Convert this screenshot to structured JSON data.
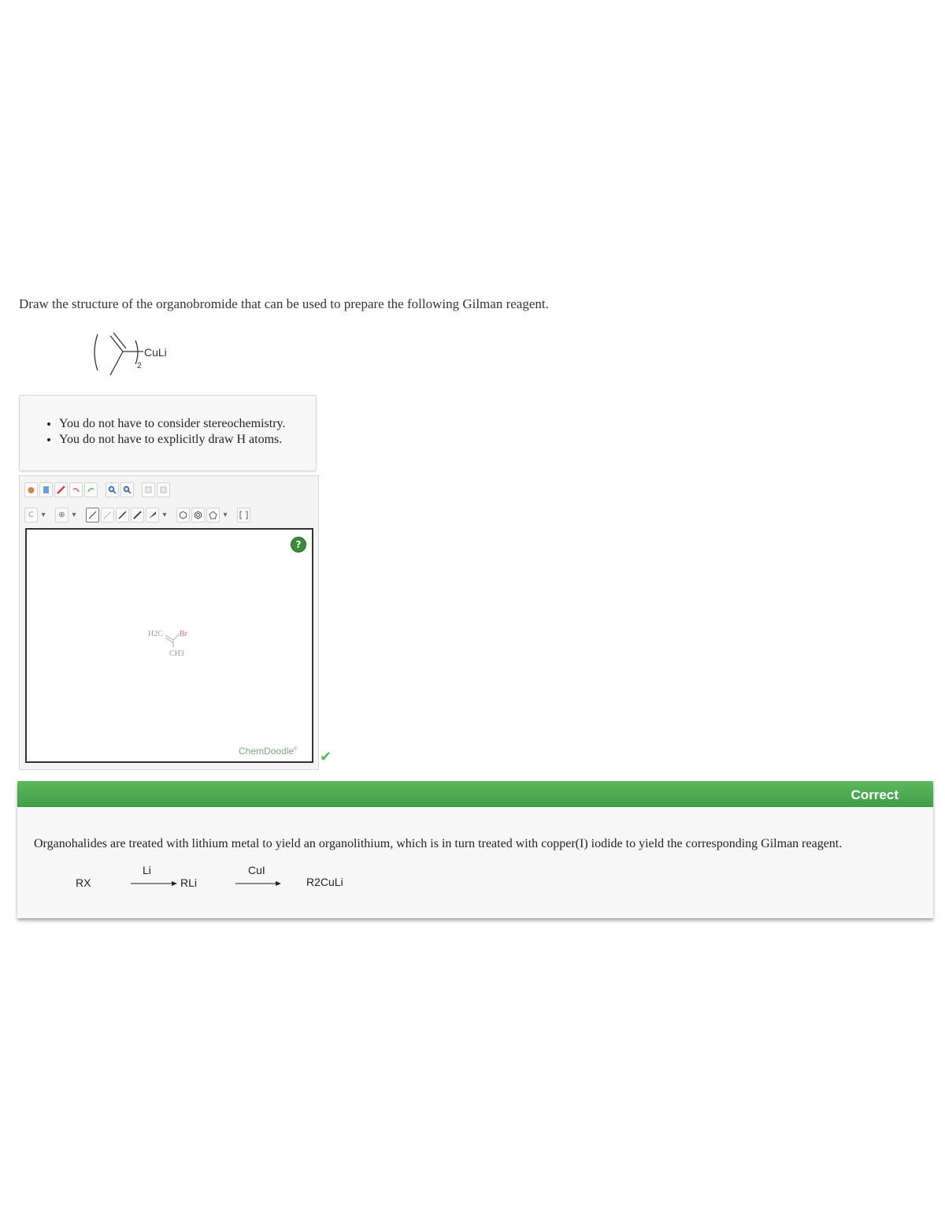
{
  "question": {
    "prompt": "Draw the structure of the organobromide that can be used to prepare the following Gilman reagent.",
    "reagent_label": "CuLi",
    "reagent_subscript": "2"
  },
  "hints": [
    "You do not have to consider stereochemistry.",
    "You do not have to explicitly draw H atoms."
  ],
  "editor": {
    "help_label": "?",
    "atom_selector": "C",
    "molecule": {
      "h2c": "H2C",
      "br": "Br",
      "ch3": "CH3"
    },
    "brand": "ChemDoodle",
    "brand_mark": "®"
  },
  "status_icon": "check-icon",
  "feedback": {
    "title": "Correct",
    "explanation": "Organohalides are treated with lithium metal to yield an organolithium, which is in turn treated with copper(I) iodide to yield the corresponding Gilman reagent.",
    "scheme": {
      "start": "RX",
      "reagent1": "Li",
      "middle": "RLi",
      "reagent2": "CuI",
      "product": "R2CuLi"
    }
  },
  "colors": {
    "correct_green": "#4cae4c",
    "check_green": "#5cb85c"
  }
}
